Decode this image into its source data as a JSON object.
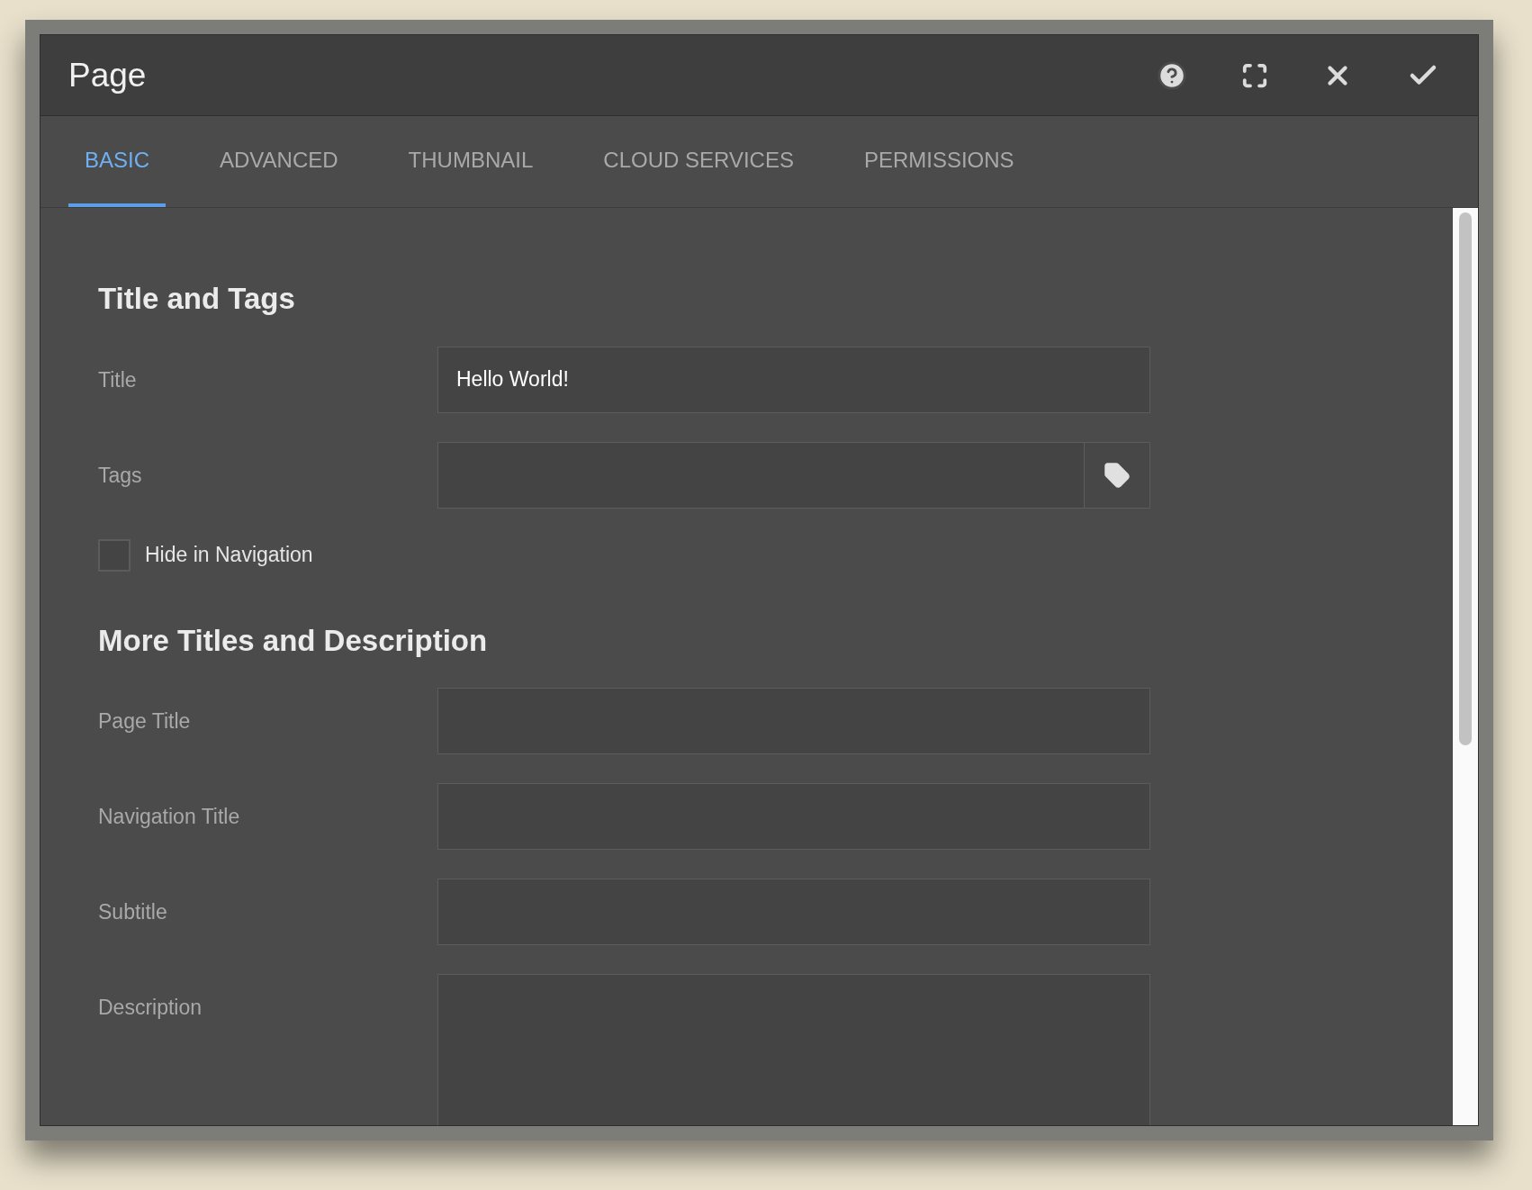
{
  "dialog": {
    "title": "Page"
  },
  "tabs": [
    {
      "label": "BASIC",
      "selected": true
    },
    {
      "label": "ADVANCED",
      "selected": false
    },
    {
      "label": "THUMBNAIL",
      "selected": false
    },
    {
      "label": "CLOUD SERVICES",
      "selected": false
    },
    {
      "label": "PERMISSIONS",
      "selected": false
    }
  ],
  "sections": [
    {
      "heading": "Title and Tags",
      "fields": [
        {
          "kind": "text",
          "label": "Title",
          "value": "Hello World!"
        },
        {
          "kind": "tags",
          "label": "Tags"
        },
        {
          "kind": "checkbox",
          "label": "Hide in Navigation",
          "checked": false
        }
      ]
    },
    {
      "heading": "More Titles and Description",
      "fields": [
        {
          "kind": "text",
          "label": "Page Title"
        },
        {
          "kind": "text",
          "label": "Navigation Title"
        },
        {
          "kind": "text",
          "label": "Subtitle"
        },
        {
          "kind": "textarea",
          "label": "Description"
        }
      ]
    }
  ]
}
